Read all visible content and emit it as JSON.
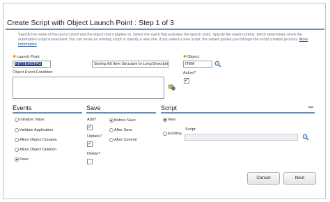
{
  "dialog": {
    "title": "Create Script with Object Launch Point : Step 1 of 3",
    "instructions": "Specify the name of the launch point and the object that it applies to. Select the event that activates the launch point. Specify the event context, which determines when the automation script is executed. You can reuse an existing script or specify a new one. If you select a new script, the wizard guides you through the script creation process.",
    "more_info_link": "More information"
  },
  "launch_point": {
    "label": "Launch Point",
    "value": "KITITEMSTRU",
    "description": "Storing Kit Item Structure to Long Description"
  },
  "object": {
    "label": "Object:",
    "value": "ITEM",
    "lookup_icon": "magnifier-icon"
  },
  "active": {
    "label": "Active?",
    "checked": true
  },
  "condition": {
    "label": "Object Event Condition:",
    "icon": "expression-builder-icon"
  },
  "events": {
    "title": "Events",
    "options": [
      {
        "label": "Initialize Value",
        "selected": false
      },
      {
        "label": "Validate Application",
        "selected": false
      },
      {
        "label": "Allow Object Creation",
        "selected": false
      },
      {
        "label": "Allow Object Deletion",
        "selected": false
      },
      {
        "label": "Save",
        "selected": true
      }
    ]
  },
  "save": {
    "title": "Save",
    "checks": [
      {
        "label": "Add?",
        "checked": true
      },
      {
        "label": "Update?",
        "checked": true
      },
      {
        "label": "Delete?",
        "checked": false
      }
    ],
    "options": [
      {
        "label": "Before Save",
        "selected": true
      },
      {
        "label": "After Save",
        "selected": false
      },
      {
        "label": "After Commit",
        "selected": false
      }
    ]
  },
  "script": {
    "title": "Script",
    "options": [
      {
        "label": "New",
        "selected": true
      },
      {
        "label": "Existing",
        "selected": false
      }
    ],
    "field_label": "Script:",
    "value": "",
    "lookup_icon": "magnifier-icon"
  },
  "buttons": {
    "cancel": "Cancel",
    "next": "Next"
  },
  "colors": {
    "accent": "#6d8fb3",
    "selection": "#1d3f8f"
  }
}
